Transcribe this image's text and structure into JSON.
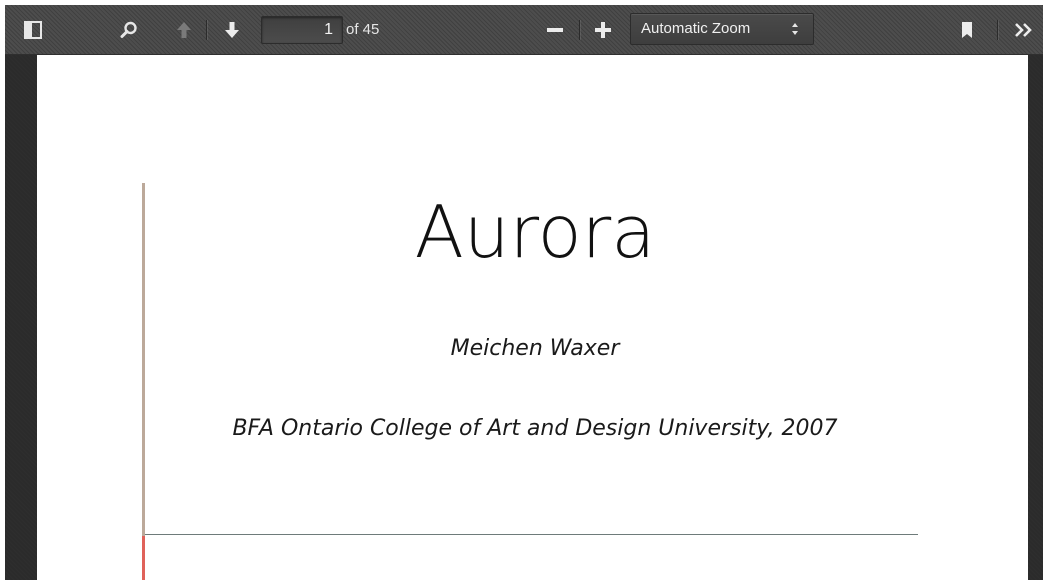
{
  "toolbar": {
    "icons": {
      "sidebar_toggle": "sidebar-toggle-icon",
      "search": "search-icon",
      "previous_page": "arrow-up-icon",
      "next_page": "arrow-down-icon",
      "zoom_out": "minus-icon",
      "zoom_in": "plus-icon",
      "bookmark": "bookmark-icon",
      "tools": "double-chevron-right-icon"
    },
    "page_number": "1",
    "page_count_label": "of 45",
    "zoom_selected": "Automatic Zoom"
  },
  "document": {
    "title": "Aurora",
    "author": "Meichen Waxer",
    "degree": "BFA Ontario College of Art and Design University, 2007"
  },
  "colors": {
    "toolbar_bg": "#474747",
    "viewer_bg": "#2b2b2b",
    "page_bg": "#ffffff",
    "margin_rule": "#bca99a",
    "margin_rule_accent": "#e0625a",
    "horizontal_rule": "#6e7b7a"
  }
}
